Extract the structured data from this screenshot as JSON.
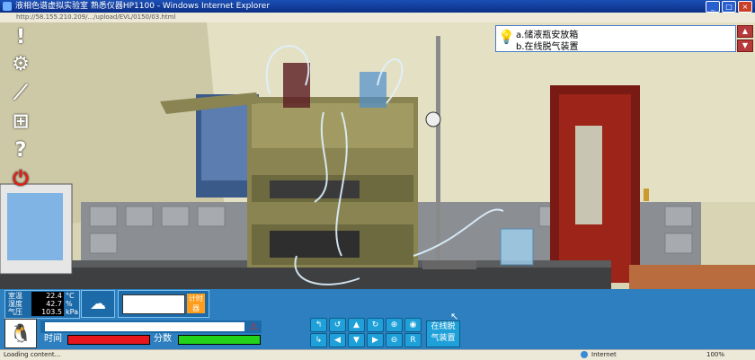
{
  "window": {
    "title": "液相色谱虚拟实验室 熟悉仪器HP1100 - Windows Internet Explorer",
    "address": "http://58.155.210.209/.../upload/EVL/0150/03.html"
  },
  "hint": {
    "line1": "a.储液瓶安放箱",
    "line2": "b.在线脱气装置"
  },
  "left_toolbar": {
    "icons": [
      "exclamation-icon",
      "gear-icon",
      "chart-icon",
      "table-icon",
      "help-icon",
      "power-icon"
    ]
  },
  "env": {
    "temp_label": "室温",
    "temp_value": "22.4",
    "temp_unit": "°C",
    "humidity_label": "湿度",
    "humidity_value": "42.7",
    "humidity_unit": "%",
    "pressure_label": "气压",
    "pressure_value": "103.5",
    "pressure_unit": "kPa"
  },
  "timer": {
    "label": "计时\n器"
  },
  "score": {
    "time_label": "时间",
    "score_label": "分数",
    "time_fraction": 1.0,
    "score_fraction": 1.0
  },
  "controls": {
    "action_button": "在线脱\n气装置"
  },
  "status": {
    "loading": "Loading content...",
    "zone": "Internet",
    "zoom": "100%"
  },
  "colors": {
    "time_fill": "#e8161c",
    "score_fill": "#22d31a",
    "accent": "#1fa0d8"
  }
}
